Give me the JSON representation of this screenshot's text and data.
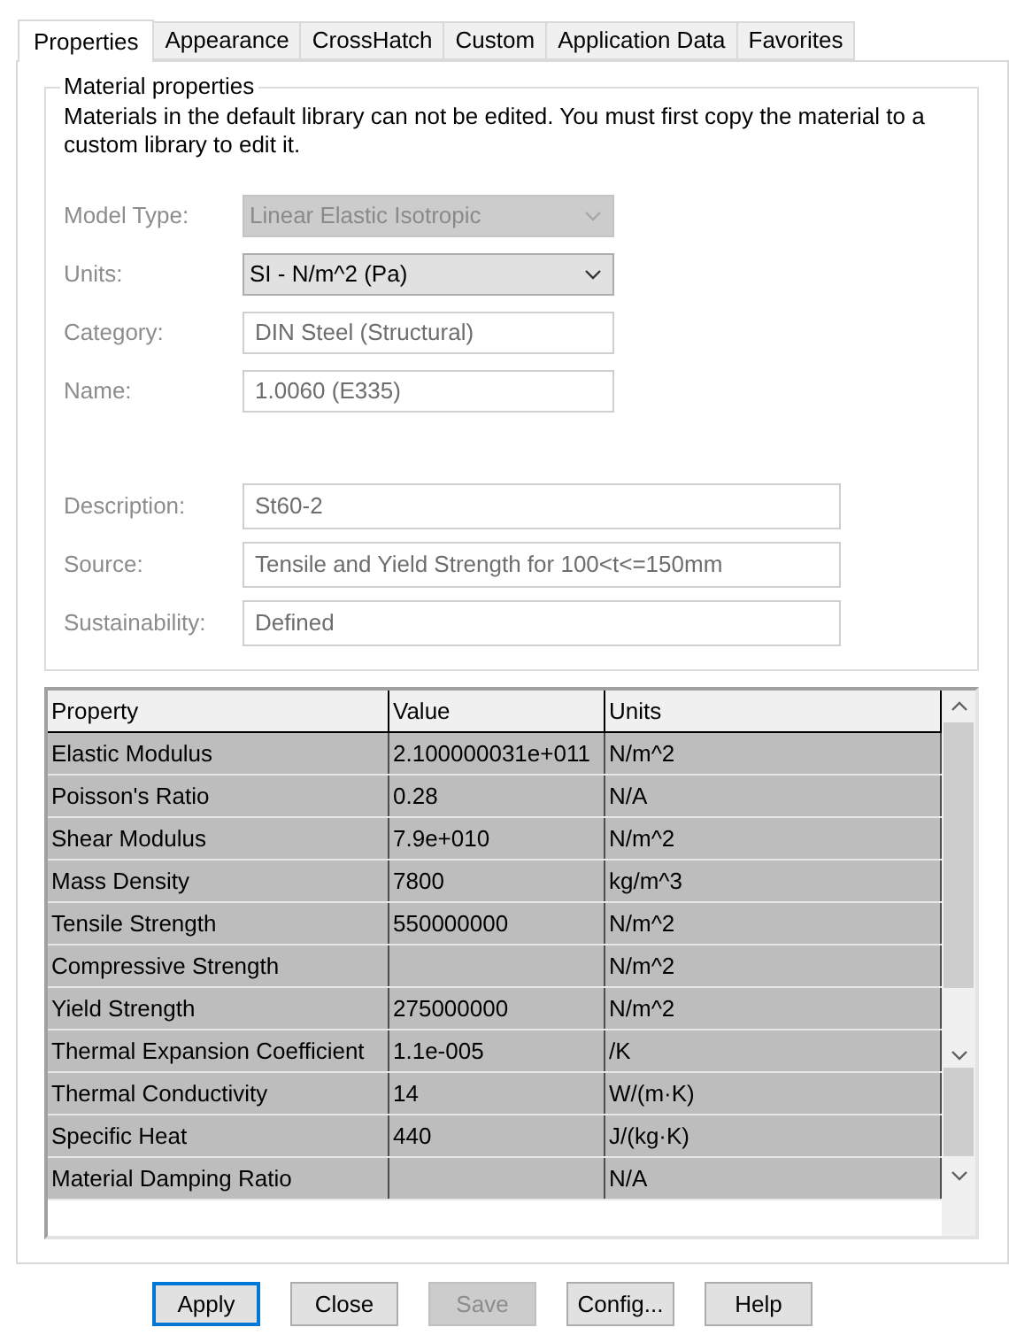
{
  "tabs": [
    {
      "label": "Properties",
      "selected": true
    },
    {
      "label": "Appearance",
      "selected": false
    },
    {
      "label": "CrossHatch",
      "selected": false
    },
    {
      "label": "Custom",
      "selected": false
    },
    {
      "label": "Application Data",
      "selected": false
    },
    {
      "label": "Favorites",
      "selected": false
    }
  ],
  "group": {
    "title": "Material properties",
    "notice": "Materials in the default library can not be edited. You must first copy the material to a custom library to edit it.",
    "fields": [
      {
        "label": "Model Type:",
        "kind": "dropdown",
        "value": "Linear Elastic Isotropic",
        "disabled": true,
        "wide": false
      },
      {
        "label": "Units:",
        "kind": "dropdown",
        "value": "SI - N/m^2 (Pa)",
        "disabled": false,
        "wide": false
      },
      {
        "label": "Category:",
        "kind": "text",
        "value": "DIN Steel (Structural)",
        "disabled": false,
        "wide": false
      },
      {
        "label": "Name:",
        "kind": "text",
        "value": "1.0060 (E335)",
        "disabled": false,
        "wide": false
      },
      {
        "kind": "spacer"
      },
      {
        "label": "Description:",
        "kind": "text",
        "value": "St60-2",
        "disabled": false,
        "wide": true
      },
      {
        "label": "Source:",
        "kind": "text",
        "value": "Tensile and Yield Strength for 100<t<=150mm",
        "disabled": false,
        "wide": true
      },
      {
        "label": "Sustainability:",
        "kind": "text",
        "value": "Defined",
        "disabled": false,
        "wide": true
      }
    ]
  },
  "table": {
    "columns": [
      "Property",
      "Value",
      "Units"
    ],
    "rows": [
      [
        "Elastic Modulus",
        "2.100000031e+011",
        "N/m^2"
      ],
      [
        "Poisson's Ratio",
        "0.28",
        "N/A"
      ],
      [
        "Shear Modulus",
        "7.9e+010",
        "N/m^2"
      ],
      [
        "Mass Density",
        "7800",
        "kg/m^3"
      ],
      [
        "Tensile Strength",
        "550000000",
        "N/m^2"
      ],
      [
        "Compressive Strength",
        "",
        "N/m^2"
      ],
      [
        "Yield Strength",
        "275000000",
        "N/m^2"
      ],
      [
        "Thermal Expansion Coefficient",
        "1.1e-005",
        "/K"
      ],
      [
        "Thermal Conductivity",
        "14",
        "W/(m·K)"
      ],
      [
        "Specific Heat",
        "440",
        "J/(kg·K)"
      ],
      [
        "Material Damping Ratio",
        "",
        "N/A"
      ]
    ]
  },
  "buttons": [
    {
      "label": "Apply",
      "kind": "default"
    },
    {
      "label": "Close",
      "kind": "normal"
    },
    {
      "label": "Save",
      "kind": "disabled"
    },
    {
      "label": "Config...",
      "kind": "normal"
    },
    {
      "label": "Help",
      "kind": "normal"
    }
  ]
}
